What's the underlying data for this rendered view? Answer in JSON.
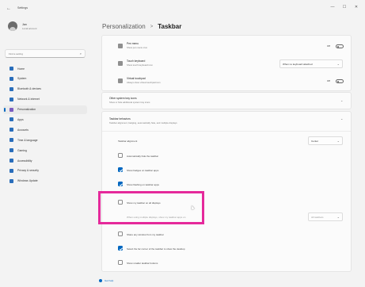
{
  "window": {
    "app_title": "Settings",
    "controls": [
      "—",
      "☐",
      "✕"
    ]
  },
  "profile": {
    "name": "Jan",
    "subtitle": "Local account"
  },
  "search": {
    "placeholder": "Find a setting"
  },
  "nav": [
    {
      "label": "Home",
      "active": false
    },
    {
      "label": "System",
      "active": false
    },
    {
      "label": "Bluetooth & devices",
      "active": false
    },
    {
      "label": "Network & internet",
      "active": false
    },
    {
      "label": "Personalization",
      "active": true
    },
    {
      "label": "Apps",
      "active": false
    },
    {
      "label": "Accounts",
      "active": false
    },
    {
      "label": "Time & language",
      "active": false
    },
    {
      "label": "Gaming",
      "active": false
    },
    {
      "label": "Accessibility",
      "active": false
    },
    {
      "label": "Privacy & security",
      "active": false
    },
    {
      "label": "Windows Update",
      "active": false
    }
  ],
  "breadcrumb": {
    "parent": "Personalization",
    "separator": ">",
    "current": "Taskbar"
  },
  "corner_rows": [
    {
      "title": "Pen menu",
      "subtitle": "Show pen menu icon",
      "control": "toggle",
      "state_label": "Off"
    },
    {
      "title": "Touch keyboard",
      "subtitle": "Show touch keyboard icon",
      "control": "dropdown",
      "value": "When no keyboard attached"
    },
    {
      "title": "Virtual touchpad",
      "subtitle": "Always show virtual touchpad icon",
      "control": "toggle",
      "state_label": "Off"
    }
  ],
  "overflow_section": {
    "title": "Other system tray icons",
    "subtitle": "Show or hide additional system tray icons"
  },
  "behaviors_section": {
    "title": "Taskbar behaviors",
    "subtitle": "Taskbar alignment, badging, automatically hide, and multiple displays",
    "alignment_label": "Taskbar alignment",
    "alignment_value": "Center",
    "options": [
      {
        "label": "Automatically hide the taskbar",
        "checked": false
      },
      {
        "label": "Show badges on taskbar apps",
        "checked": true
      },
      {
        "label": "Show flashing on taskbar apps",
        "checked": true
      },
      {
        "label": "Show my taskbar on all displays",
        "checked": false
      },
      {
        "label": "When using multiple displays, show my taskbar apps on",
        "checked": false,
        "dropdown": "All taskbars"
      },
      {
        "label": "Share any window from my taskbar",
        "checked": false
      },
      {
        "label": "Select the far corner of the taskbar to show the desktop",
        "checked": true
      },
      {
        "label": "Show smaller taskbar buttons",
        "checked": false
      }
    ]
  },
  "help": {
    "label": "Get help"
  },
  "colors": {
    "accent": "#0067c0",
    "highlight": "#e5299b"
  }
}
